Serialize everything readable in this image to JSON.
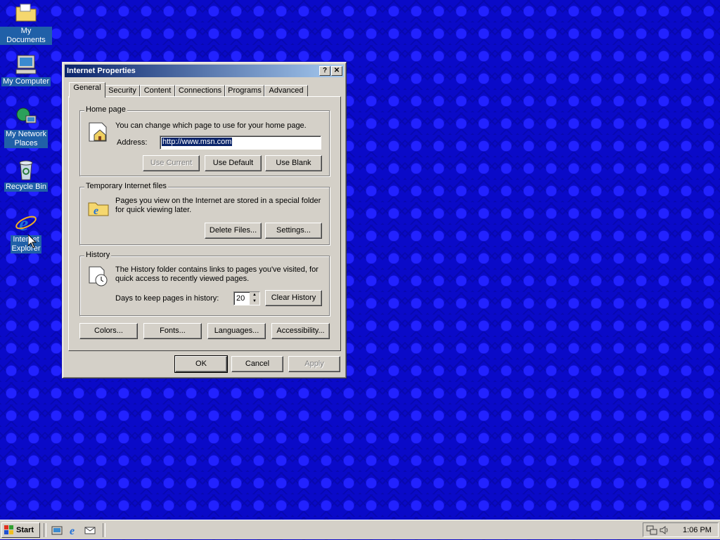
{
  "desktop": {
    "icons": [
      {
        "label": "My Documents"
      },
      {
        "label": "My Computer"
      },
      {
        "label_line1": "My Network",
        "label_line2": "Places"
      },
      {
        "label": "Recycle Bin"
      },
      {
        "label_line1": "Internet",
        "label_line2": "Explorer"
      }
    ]
  },
  "dialog": {
    "title": "Internet Properties",
    "help_btn": "?",
    "close_btn": "✕",
    "tabs": [
      "General",
      "Security",
      "Content",
      "Connections",
      "Programs",
      "Advanced"
    ],
    "home_page": {
      "title": "Home page",
      "description": "You can change which page to use for your home page.",
      "address_label": "Address:",
      "address_value": "http://www.msn.com",
      "use_current": "Use Current",
      "use_default": "Use Default",
      "use_blank": "Use Blank"
    },
    "temp_files": {
      "title": "Temporary Internet files",
      "description_line1": "Pages you view on the Internet are stored in a special folder",
      "description_line2": "for quick viewing later.",
      "delete_files": "Delete Files...",
      "settings": "Settings..."
    },
    "history": {
      "title": "History",
      "description_line1": "The History folder contains links to pages you've visited, for",
      "description_line2": "quick access to recently viewed pages.",
      "days_label": "Days to keep pages in history:",
      "days_value": "20",
      "clear_history": "Clear History"
    },
    "bottom_buttons": {
      "colors": "Colors...",
      "fonts": "Fonts...",
      "languages": "Languages...",
      "accessibility": "Accessibility..."
    },
    "ok": "OK",
    "cancel": "Cancel",
    "apply": "Apply"
  },
  "taskbar": {
    "start_label": "Start",
    "clock": "1:06 PM"
  }
}
